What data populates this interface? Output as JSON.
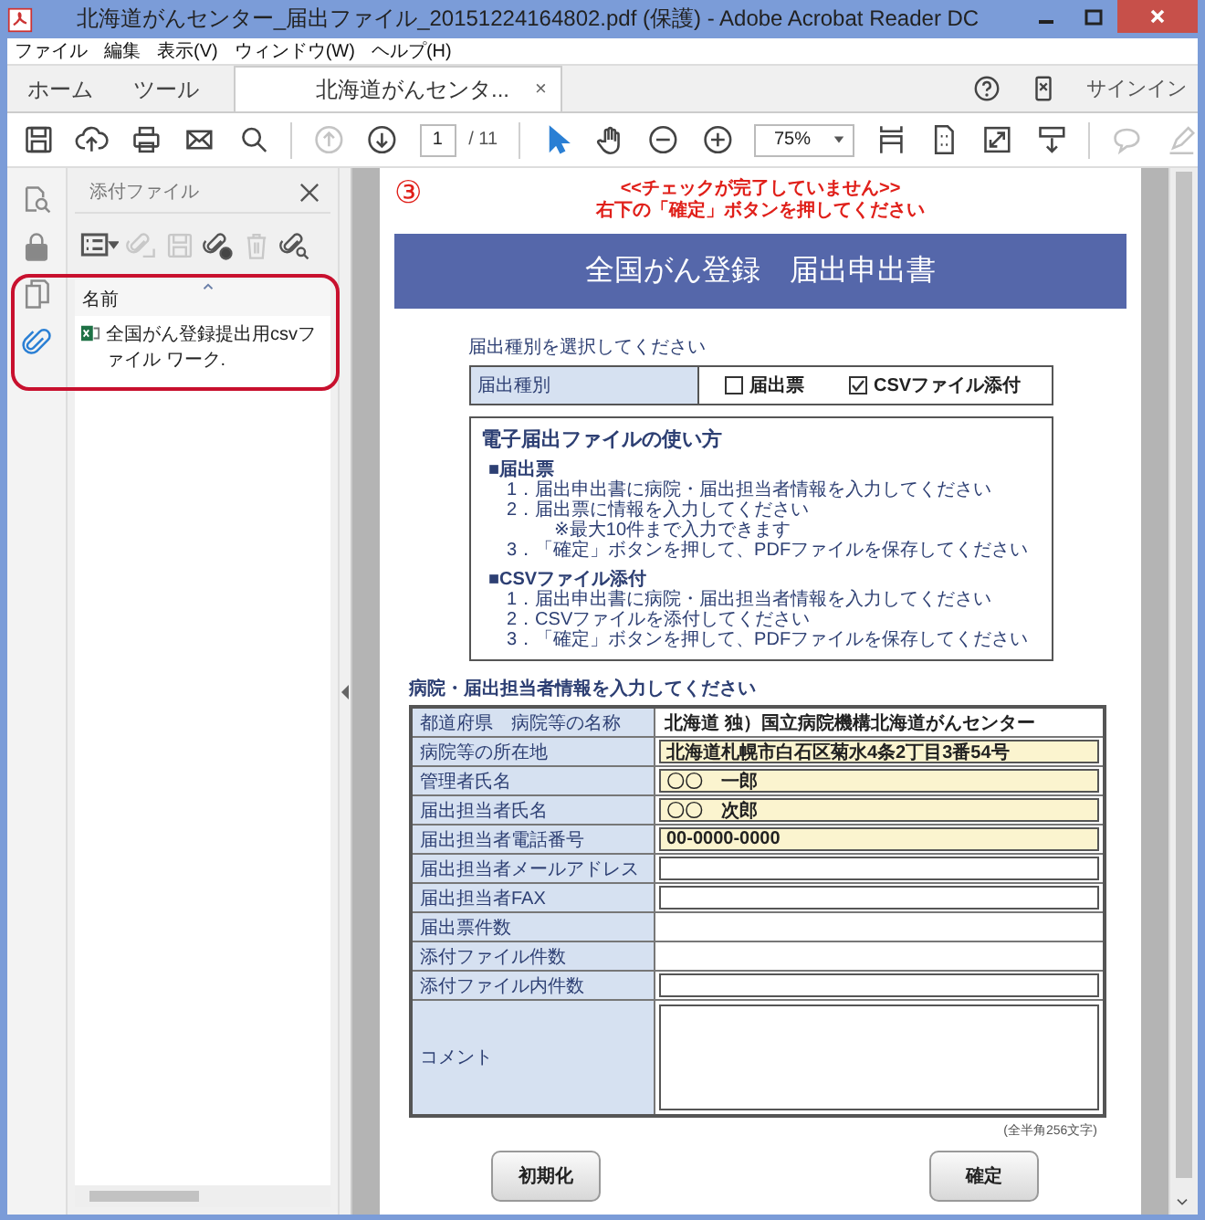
{
  "window": {
    "title": "北海道がんセンター_届出ファイル_20151224164802.pdf (保護) - Adobe Acrobat Reader DC"
  },
  "menu": [
    {
      "label": "ファイル"
    },
    {
      "label": "編集"
    },
    {
      "label": "表示(V)"
    },
    {
      "label": "ウィンドウ(W)"
    },
    {
      "label": "ヘルプ(H)"
    }
  ],
  "tabs": [
    {
      "label": "ホーム",
      "selected": false
    },
    {
      "label": "ツール",
      "selected": false
    },
    {
      "label": "北海道がんセンタ...",
      "selected": true,
      "close": "×"
    }
  ],
  "sign_in": "サインイン",
  "toolbar": [
    {
      "kind": "save",
      "disabled": false
    },
    {
      "kind": "upload",
      "disabled": false
    },
    {
      "kind": "print",
      "disabled": false
    },
    {
      "kind": "mail",
      "disabled": false
    },
    {
      "kind": "search",
      "disabled": false
    },
    {
      "kind": "separator"
    },
    {
      "kind": "prev",
      "disabled": true
    },
    {
      "kind": "next",
      "disabled": false
    },
    {
      "kind": "page",
      "value": "1",
      "total": "/ 11"
    },
    {
      "kind": "separator"
    },
    {
      "kind": "select",
      "disabled": false
    },
    {
      "kind": "hand",
      "disabled": false
    },
    {
      "kind": "zoomout",
      "disabled": false
    },
    {
      "kind": "zoomin",
      "disabled": false
    },
    {
      "kind": "zoom",
      "value": "75%"
    },
    {
      "kind": "fit",
      "disabled": false
    },
    {
      "kind": "page_view",
      "disabled": false
    },
    {
      "kind": "fullscreen",
      "disabled": false
    },
    {
      "kind": "scroll",
      "disabled": false
    },
    {
      "kind": "separator"
    },
    {
      "kind": "comment",
      "disabled": true
    },
    {
      "kind": "pen",
      "disabled": true
    }
  ],
  "rail": [
    {
      "kind": "search",
      "selected": false
    },
    {
      "kind": "lock",
      "selected": false
    },
    {
      "kind": "pages",
      "selected": false
    },
    {
      "kind": "attach",
      "selected": true
    }
  ],
  "attachments": {
    "title": "添付ファイル",
    "highlighted": true,
    "tools": [
      {
        "kind": "view",
        "disabled": false
      },
      {
        "kind": "open",
        "disabled": true
      },
      {
        "kind": "save",
        "disabled": true
      },
      {
        "kind": "add",
        "disabled": false
      },
      {
        "kind": "delete",
        "disabled": true
      },
      {
        "kind": "find",
        "disabled": false
      }
    ],
    "column": "名前",
    "files": [
      {
        "name": "全国がん登録提出用csvファイル ワーク."
      }
    ]
  },
  "document": {
    "marker": "③",
    "notice": [
      "<<チェックが完了していません>>",
      "右下の「確定」ボタンを押してください"
    ],
    "banner": "全国がん登録　届出申出書",
    "type_heading": "届出種別を選択してください",
    "type_label": "届出種別",
    "type_options": [
      {
        "label": "届出票",
        "checked": false
      },
      {
        "label": "CSVファイル添付",
        "checked": true
      }
    ],
    "guide": {
      "title": "電子届出ファイルの使い方",
      "sections": [
        {
          "heading": "■届出票",
          "steps": [
            {
              "kind": "step",
              "text": "1．届出申出書に病院・届出担当者情報を入力してください"
            },
            {
              "kind": "step",
              "text": "2．届出票に情報を入力してください"
            },
            {
              "kind": "note",
              "text": "※最大10件まで入力できます"
            },
            {
              "kind": "step",
              "text": "3．「確定」ボタンを押して、PDFファイルを保存してください"
            }
          ]
        },
        {
          "heading": "■CSVファイル添付",
          "steps": [
            {
              "kind": "step",
              "text": "1．届出申出書に病院・届出担当者情報を入力してください"
            },
            {
              "kind": "step",
              "text": "2．CSVファイルを添付してください"
            },
            {
              "kind": "step",
              "text": "3．「確定」ボタンを押して、PDFファイルを保存してください"
            }
          ]
        }
      ]
    },
    "info_heading": "病院・届出担当者情報を入力してください",
    "rows": [
      {
        "label": "都道府県　病院等の名称",
        "kind": "plain",
        "value": "北海道 独）国立病院機構北海道がんセンター"
      },
      {
        "label": "病院等の所在地",
        "kind": "field",
        "filled": true,
        "value": "北海道札幌市白石区菊水4条2丁目3番54号"
      },
      {
        "label": "管理者氏名",
        "kind": "field",
        "filled": true,
        "value": "〇〇　一郎"
      },
      {
        "label": "届出担当者氏名",
        "kind": "field",
        "filled": true,
        "value": "〇〇　次郎"
      },
      {
        "label": "届出担当者電話番号",
        "kind": "field",
        "filled": true,
        "value": "00-0000-0000"
      },
      {
        "label": "届出担当者メールアドレス",
        "kind": "field",
        "filled": false
      },
      {
        "label": "届出担当者FAX",
        "kind": "field",
        "filled": false
      },
      {
        "label": "届出票件数",
        "kind": "plain"
      },
      {
        "label": "添付ファイル件数",
        "kind": "plain"
      },
      {
        "label": "添付ファイル内件数",
        "kind": "field",
        "filled": false
      },
      {
        "label": "コメント",
        "kind": "area",
        "filled": false
      }
    ],
    "footnote": "(全半角256文字)",
    "buttons": [
      "初期化",
      "確定"
    ]
  }
}
